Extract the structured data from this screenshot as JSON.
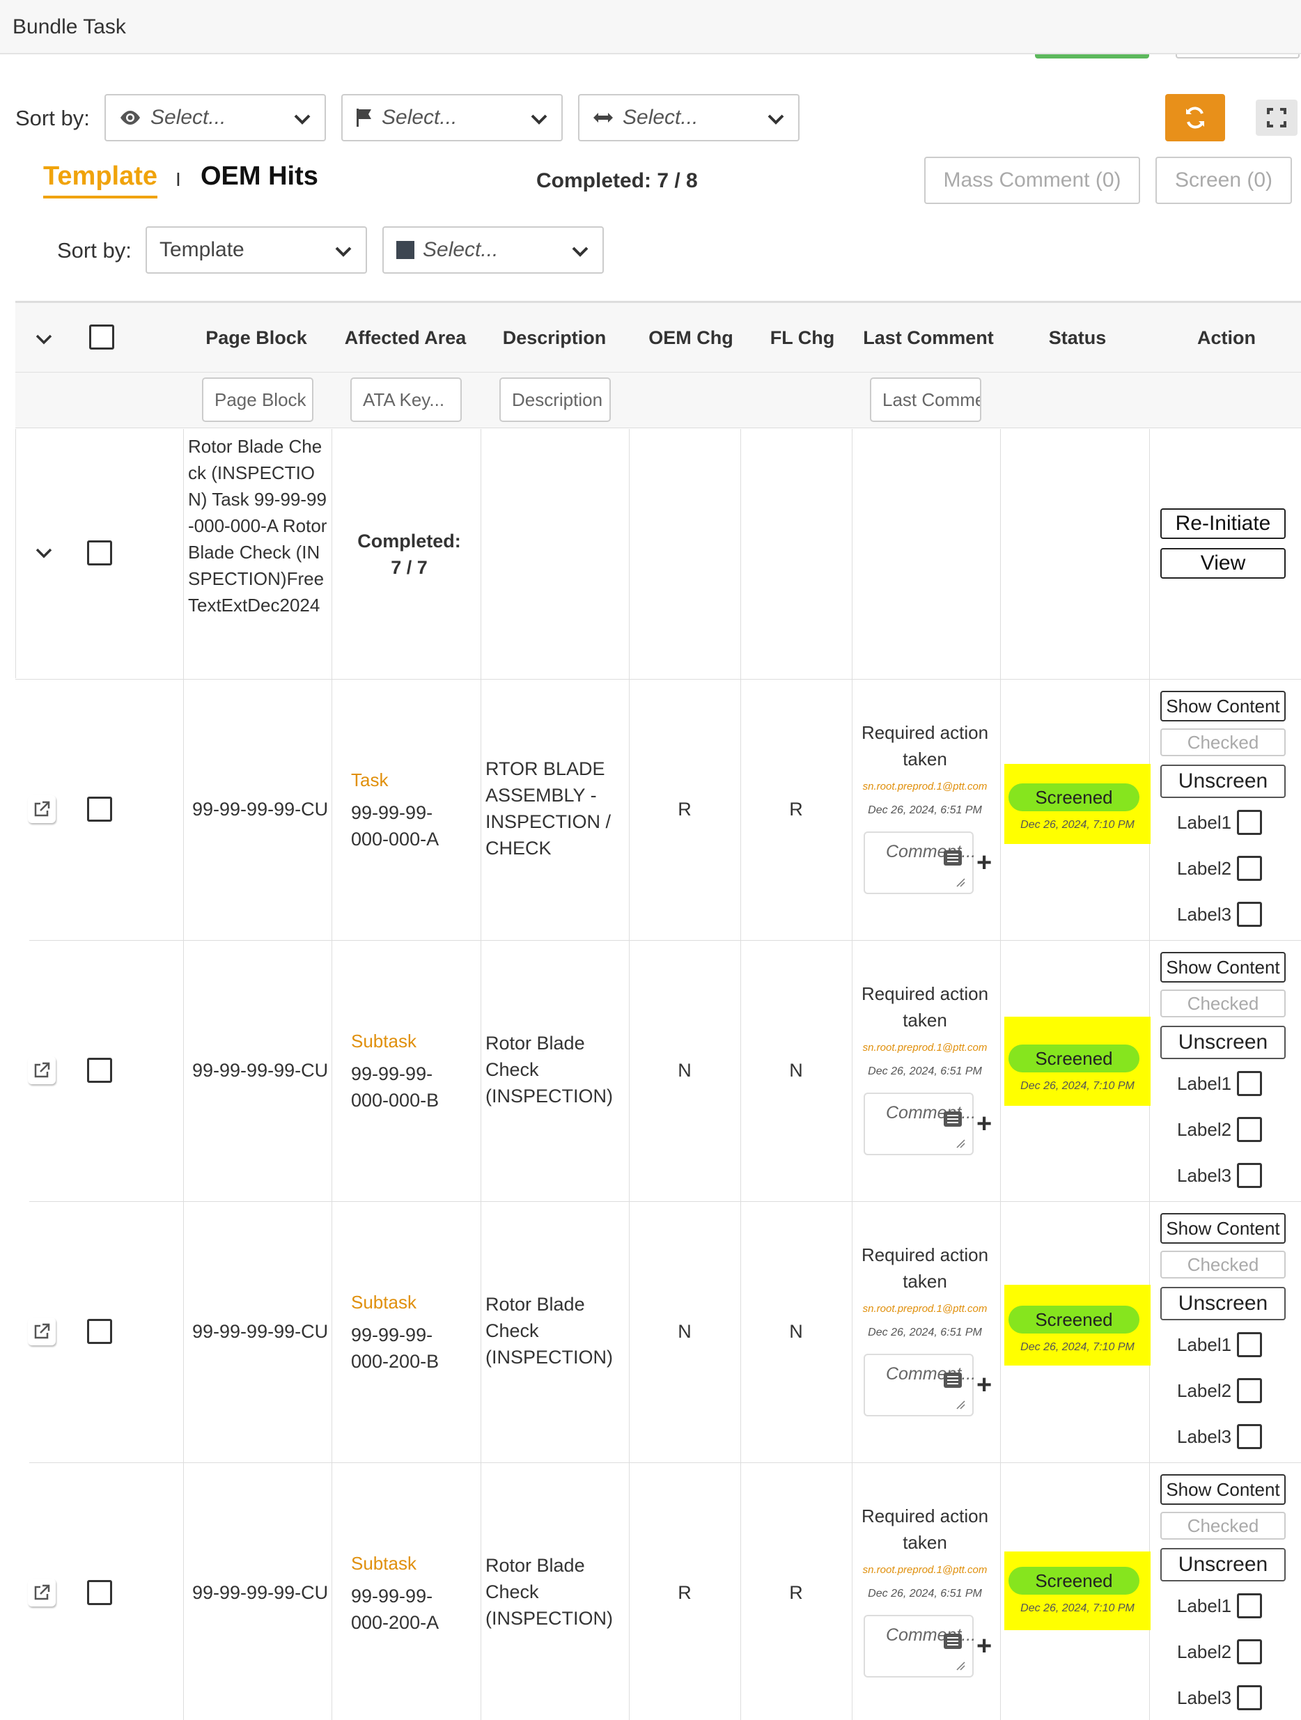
{
  "window": {
    "title": "Bundle Task"
  },
  "toolbar": {
    "sort_label": "Sort by:",
    "select_placeholder_1": "Select...",
    "select_placeholder_2": "Select...",
    "select_placeholder_3": "Select...",
    "refresh_icon": "refresh-icon",
    "fullscreen_icon": "fullscreen-icon"
  },
  "tabs": {
    "template": "Template",
    "separator": "I",
    "oem_hits": "OEM Hits",
    "completed": "Completed: 7 / 8",
    "mass_comment": "Mass Comment (0)",
    "screen": "Screen (0)"
  },
  "subsort": {
    "label": "Sort by:",
    "template_value": "Template",
    "select_placeholder": "Select..."
  },
  "table": {
    "headers": {
      "page_block": "Page Block",
      "affected_area": "Affected Area",
      "description": "Description",
      "oem_chg": "OEM Chg",
      "fl_chg": "FL Chg",
      "last_comment": "Last Comment",
      "status": "Status",
      "action": "Action"
    },
    "filters": {
      "page_block": "Page Block",
      "ata_key": "ATA Key...",
      "description": "Description",
      "last_comment": "Last Comment"
    },
    "parent_row": {
      "page_block": "Rotor Blade Check (INSPECTION) Task 99-99-99-000-000-A Rotor Blade Check (INSPECTION)FreeTextExtDec2024",
      "completed_label": "Completed:",
      "completed_value": "7 / 7",
      "reinitiate": "Re-Initiate",
      "view": "View"
    },
    "rows": [
      {
        "page_block": "99-99-99-99-CU",
        "type": "Task",
        "affected": "99-99-99-000-000-A",
        "desc": "RTOR BLADE ASSEMBLY - INSPECTION / CHECK",
        "oem_chg": "R",
        "fl_chg": "R",
        "comment": "Required action taken",
        "author": "sn.root.preprod.1@ptt.com",
        "comment_date": "Dec 26, 2024, 6:51 PM",
        "comment_placeholder": "Comment...",
        "status": "Screened",
        "status_date": "Dec 26, 2024, 7:10 PM",
        "show_content": "Show Content",
        "checked": "Checked",
        "unscreen": "Unscreen",
        "label1": "Label1",
        "label2": "Label2",
        "label3": "Label3"
      },
      {
        "page_block": "99-99-99-99-CU",
        "type": "Subtask",
        "affected": "99-99-99-000-000-B",
        "desc": "Rotor Blade Check (INSPECTION)",
        "oem_chg": "N",
        "fl_chg": "N",
        "comment": "Required action taken",
        "author": "sn.root.preprod.1@ptt.com",
        "comment_date": "Dec 26, 2024, 6:51 PM",
        "comment_placeholder": "Comment...",
        "status": "Screened",
        "status_date": "Dec 26, 2024, 7:10 PM",
        "show_content": "Show Content",
        "checked": "Checked",
        "unscreen": "Unscreen",
        "label1": "Label1",
        "label2": "Label2",
        "label3": "Label3"
      },
      {
        "page_block": "99-99-99-99-CU",
        "type": "Subtask",
        "affected": "99-99-99-000-200-B",
        "desc": "Rotor Blade Check (INSPECTION)",
        "oem_chg": "N",
        "fl_chg": "N",
        "comment": "Required action taken",
        "author": "sn.root.preprod.1@ptt.com",
        "comment_date": "Dec 26, 2024, 6:51 PM",
        "comment_placeholder": "Comment...",
        "status": "Screened",
        "status_date": "Dec 26, 2024, 7:10 PM",
        "show_content": "Show Content",
        "checked": "Checked",
        "unscreen": "Unscreen",
        "label1": "Label1",
        "label2": "Label2",
        "label3": "Label3"
      },
      {
        "page_block": "99-99-99-99-CU",
        "type": "Subtask",
        "affected": "99-99-99-000-200-A",
        "desc": "Rotor Blade Check (INSPECTION)",
        "oem_chg": "R",
        "fl_chg": "R",
        "comment": "Required action taken",
        "author": "sn.root.preprod.1@ptt.com",
        "comment_date": "Dec 26, 2024, 6:51 PM",
        "comment_placeholder": "Comment...",
        "status": "Screened",
        "status_date": "Dec 26, 2024, 7:10 PM",
        "show_content": "Show Content",
        "checked": "Checked",
        "unscreen": "Unscreen",
        "label1": "Label1",
        "label2": "Label2",
        "label3": "Label3"
      }
    ]
  },
  "colors": {
    "accent_orange": "#f0a30a",
    "refresh_button": "#e8901a",
    "status_highlight": "#ffff00",
    "screened_pill": "#86e51e"
  }
}
